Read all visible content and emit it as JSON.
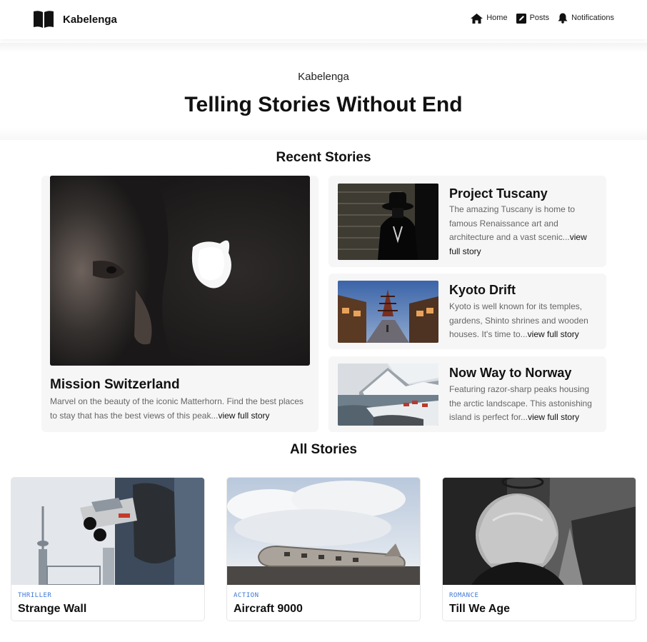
{
  "header": {
    "brand": "Kabelenga",
    "brand_icon": "open-book-icon",
    "nav": [
      {
        "label": "Home",
        "icon": "home-icon"
      },
      {
        "label": "Posts",
        "icon": "edit-icon"
      },
      {
        "label": "Notifications",
        "icon": "bell-icon"
      }
    ]
  },
  "hero": {
    "subtitle": "Kabelenga",
    "title": "Telling Stories Without End"
  },
  "recent": {
    "heading": "Recent Stories",
    "featured": {
      "title": "Mission Switzerland",
      "excerpt": "Marvel on the beauty of the iconic Matterhorn. Find the best places to stay that has the best views of this peak...",
      "more": "view full story"
    },
    "items": [
      {
        "title": "Project Tuscany",
        "excerpt": "The amazing Tuscany is home to famous Renaissance art and architecture and a vast scenic...",
        "more": "view full story"
      },
      {
        "title": "Kyoto Drift",
        "excerpt": "Kyoto is well known for its temples, gardens, Shinto shrines and wooden houses. It's time to...",
        "more": "view full story"
      },
      {
        "title": "Now Way to Norway",
        "excerpt": "Featuring razor-sharp peaks housing the arctic landscape. This astonishing island is perfect for...",
        "more": "view full story"
      }
    ]
  },
  "all": {
    "heading": "All Stories",
    "stories": [
      {
        "category": "THRILLER",
        "title": "Strange Wall"
      },
      {
        "category": "ACTION",
        "title": "Aircraft 9000"
      },
      {
        "category": "ROMANCE",
        "title": "Till We Age"
      }
    ]
  },
  "colors": {
    "category": "#3d78d6",
    "card_bg": "#f6f6f6",
    "excerpt": "#666666"
  }
}
